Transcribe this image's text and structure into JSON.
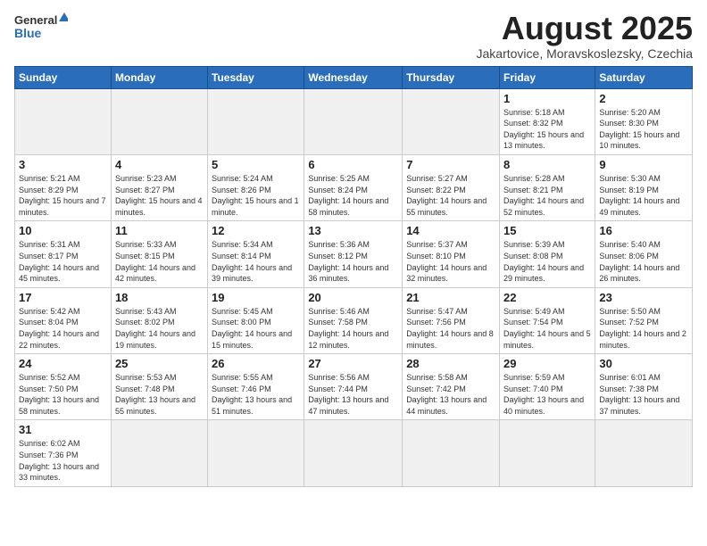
{
  "header": {
    "logo_general": "General",
    "logo_blue": "Blue",
    "main_title": "August 2025",
    "subtitle": "Jakartovice, Moravskoslezsky, Czechia"
  },
  "columns": [
    "Sunday",
    "Monday",
    "Tuesday",
    "Wednesday",
    "Thursday",
    "Friday",
    "Saturday"
  ],
  "weeks": [
    [
      {
        "day": "",
        "info": ""
      },
      {
        "day": "",
        "info": ""
      },
      {
        "day": "",
        "info": ""
      },
      {
        "day": "",
        "info": ""
      },
      {
        "day": "",
        "info": ""
      },
      {
        "day": "1",
        "info": "Sunrise: 5:18 AM\nSunset: 8:32 PM\nDaylight: 15 hours\nand 13 minutes."
      },
      {
        "day": "2",
        "info": "Sunrise: 5:20 AM\nSunset: 8:30 PM\nDaylight: 15 hours\nand 10 minutes."
      }
    ],
    [
      {
        "day": "3",
        "info": "Sunrise: 5:21 AM\nSunset: 8:29 PM\nDaylight: 15 hours\nand 7 minutes."
      },
      {
        "day": "4",
        "info": "Sunrise: 5:23 AM\nSunset: 8:27 PM\nDaylight: 15 hours\nand 4 minutes."
      },
      {
        "day": "5",
        "info": "Sunrise: 5:24 AM\nSunset: 8:26 PM\nDaylight: 15 hours\nand 1 minute."
      },
      {
        "day": "6",
        "info": "Sunrise: 5:25 AM\nSunset: 8:24 PM\nDaylight: 14 hours\nand 58 minutes."
      },
      {
        "day": "7",
        "info": "Sunrise: 5:27 AM\nSunset: 8:22 PM\nDaylight: 14 hours\nand 55 minutes."
      },
      {
        "day": "8",
        "info": "Sunrise: 5:28 AM\nSunset: 8:21 PM\nDaylight: 14 hours\nand 52 minutes."
      },
      {
        "day": "9",
        "info": "Sunrise: 5:30 AM\nSunset: 8:19 PM\nDaylight: 14 hours\nand 49 minutes."
      }
    ],
    [
      {
        "day": "10",
        "info": "Sunrise: 5:31 AM\nSunset: 8:17 PM\nDaylight: 14 hours\nand 45 minutes."
      },
      {
        "day": "11",
        "info": "Sunrise: 5:33 AM\nSunset: 8:15 PM\nDaylight: 14 hours\nand 42 minutes."
      },
      {
        "day": "12",
        "info": "Sunrise: 5:34 AM\nSunset: 8:14 PM\nDaylight: 14 hours\nand 39 minutes."
      },
      {
        "day": "13",
        "info": "Sunrise: 5:36 AM\nSunset: 8:12 PM\nDaylight: 14 hours\nand 36 minutes."
      },
      {
        "day": "14",
        "info": "Sunrise: 5:37 AM\nSunset: 8:10 PM\nDaylight: 14 hours\nand 32 minutes."
      },
      {
        "day": "15",
        "info": "Sunrise: 5:39 AM\nSunset: 8:08 PM\nDaylight: 14 hours\nand 29 minutes."
      },
      {
        "day": "16",
        "info": "Sunrise: 5:40 AM\nSunset: 8:06 PM\nDaylight: 14 hours\nand 26 minutes."
      }
    ],
    [
      {
        "day": "17",
        "info": "Sunrise: 5:42 AM\nSunset: 8:04 PM\nDaylight: 14 hours\nand 22 minutes."
      },
      {
        "day": "18",
        "info": "Sunrise: 5:43 AM\nSunset: 8:02 PM\nDaylight: 14 hours\nand 19 minutes."
      },
      {
        "day": "19",
        "info": "Sunrise: 5:45 AM\nSunset: 8:00 PM\nDaylight: 14 hours\nand 15 minutes."
      },
      {
        "day": "20",
        "info": "Sunrise: 5:46 AM\nSunset: 7:58 PM\nDaylight: 14 hours\nand 12 minutes."
      },
      {
        "day": "21",
        "info": "Sunrise: 5:47 AM\nSunset: 7:56 PM\nDaylight: 14 hours\nand 8 minutes."
      },
      {
        "day": "22",
        "info": "Sunrise: 5:49 AM\nSunset: 7:54 PM\nDaylight: 14 hours\nand 5 minutes."
      },
      {
        "day": "23",
        "info": "Sunrise: 5:50 AM\nSunset: 7:52 PM\nDaylight: 14 hours\nand 2 minutes."
      }
    ],
    [
      {
        "day": "24",
        "info": "Sunrise: 5:52 AM\nSunset: 7:50 PM\nDaylight: 13 hours\nand 58 minutes."
      },
      {
        "day": "25",
        "info": "Sunrise: 5:53 AM\nSunset: 7:48 PM\nDaylight: 13 hours\nand 55 minutes."
      },
      {
        "day": "26",
        "info": "Sunrise: 5:55 AM\nSunset: 7:46 PM\nDaylight: 13 hours\nand 51 minutes."
      },
      {
        "day": "27",
        "info": "Sunrise: 5:56 AM\nSunset: 7:44 PM\nDaylight: 13 hours\nand 47 minutes."
      },
      {
        "day": "28",
        "info": "Sunrise: 5:58 AM\nSunset: 7:42 PM\nDaylight: 13 hours\nand 44 minutes."
      },
      {
        "day": "29",
        "info": "Sunrise: 5:59 AM\nSunset: 7:40 PM\nDaylight: 13 hours\nand 40 minutes."
      },
      {
        "day": "30",
        "info": "Sunrise: 6:01 AM\nSunset: 7:38 PM\nDaylight: 13 hours\nand 37 minutes."
      }
    ],
    [
      {
        "day": "31",
        "info": "Sunrise: 6:02 AM\nSunset: 7:36 PM\nDaylight: 13 hours\nand 33 minutes."
      },
      {
        "day": "",
        "info": ""
      },
      {
        "day": "",
        "info": ""
      },
      {
        "day": "",
        "info": ""
      },
      {
        "day": "",
        "info": ""
      },
      {
        "day": "",
        "info": ""
      },
      {
        "day": "",
        "info": ""
      }
    ]
  ]
}
